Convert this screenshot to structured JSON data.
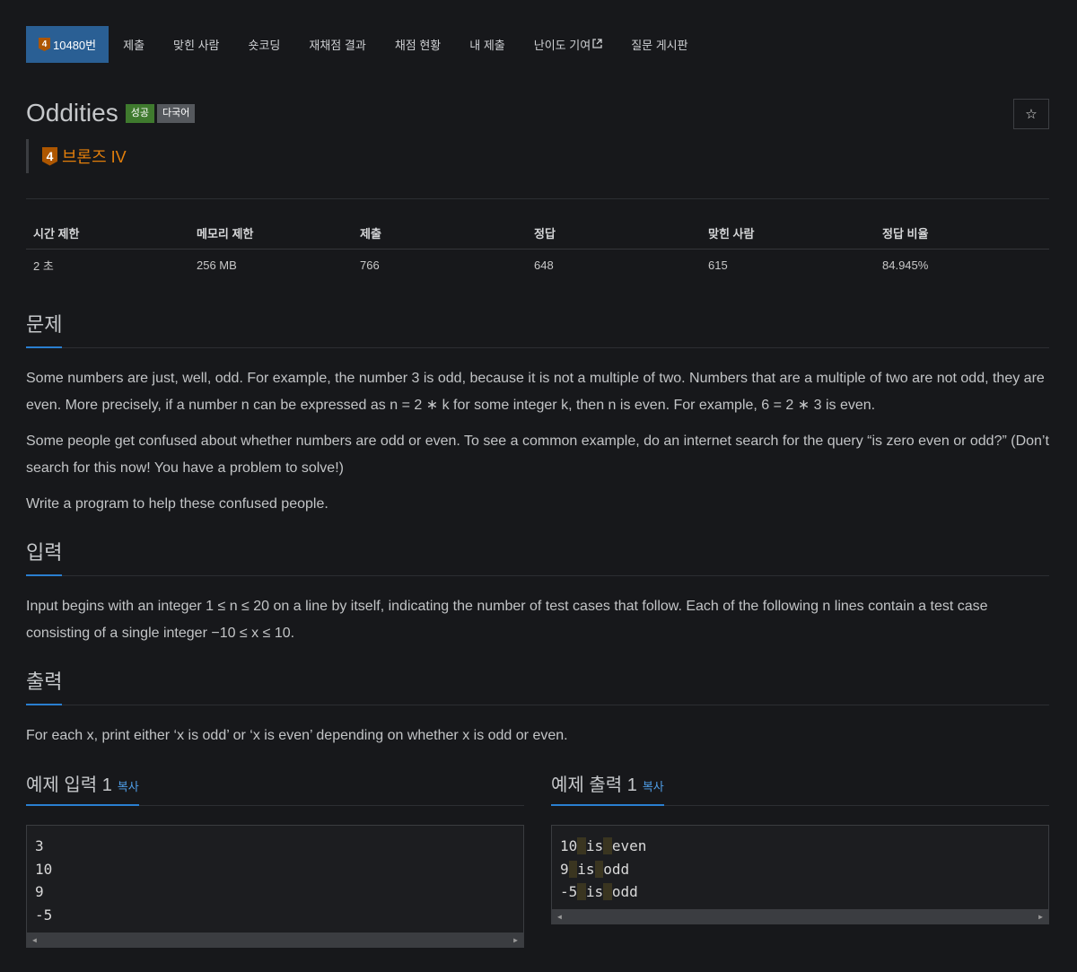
{
  "nav": {
    "tabs": [
      {
        "label": "10480번",
        "tier": "4",
        "active": true
      },
      {
        "label": "제출"
      },
      {
        "label": "맞힌 사람"
      },
      {
        "label": "숏코딩"
      },
      {
        "label": "재채점 결과"
      },
      {
        "label": "채점 현황"
      },
      {
        "label": "내 제출"
      },
      {
        "label": "난이도 기여"
      },
      {
        "label": "질문 게시판"
      }
    ]
  },
  "problem": {
    "title": "Oddities",
    "labels": {
      "success": "성공",
      "multi": "다국어"
    },
    "tier_number": "4",
    "tier_name": "브론즈 IV",
    "tier_color": "#e47f0b"
  },
  "stats": {
    "headers": [
      "시간 제한",
      "메모리 제한",
      "제출",
      "정답",
      "맞힌 사람",
      "정답 비율"
    ],
    "values": [
      "2 초",
      "256 MB",
      "766",
      "648",
      "615",
      "84.945%"
    ]
  },
  "sections": {
    "problem_title": "문제",
    "problem_paragraphs": [
      "Some numbers are just, well, odd. For example, the number 3 is odd, because it is not a multiple of two. Numbers that are a multiple of two are not odd, they are even. More precisely, if a number n can be expressed as n = 2 ∗ k for some integer k, then n is even. For example, 6 = 2 ∗ 3 is even.",
      "Some people get confused about whether numbers are odd or even. To see a common example, do an internet search for the query “is zero even or odd?” (Don’t search for this now! You have a problem to solve!)",
      "Write a program to help these confused people."
    ],
    "input_title": "입력",
    "input_text": "Input begins with an integer 1 ≤ n ≤ 20 on a line by itself, indicating the number of test cases that follow. Each of the following n lines contain a test case consisting of a single integer −10 ≤ x ≤ 10.",
    "output_title": "출력",
    "output_text": "For each x, print either ‘x is odd’ or ‘x is even’ depending on whether x is odd or even."
  },
  "samples": {
    "copy_label": "복사",
    "input_title": "예제 입력 1",
    "input_lines": [
      "3",
      "10",
      "9",
      "-5"
    ],
    "output_title": "예제 출력 1",
    "output_lines": [
      [
        "10",
        "is",
        "even"
      ],
      [
        "9",
        "is",
        "odd"
      ],
      [
        "-5",
        "is",
        "odd"
      ]
    ]
  },
  "colors": {
    "accent": "#2a7fd0",
    "active_tab": "#2a5f94",
    "success": "#3f7a2e",
    "bronze": "#ad5600"
  }
}
